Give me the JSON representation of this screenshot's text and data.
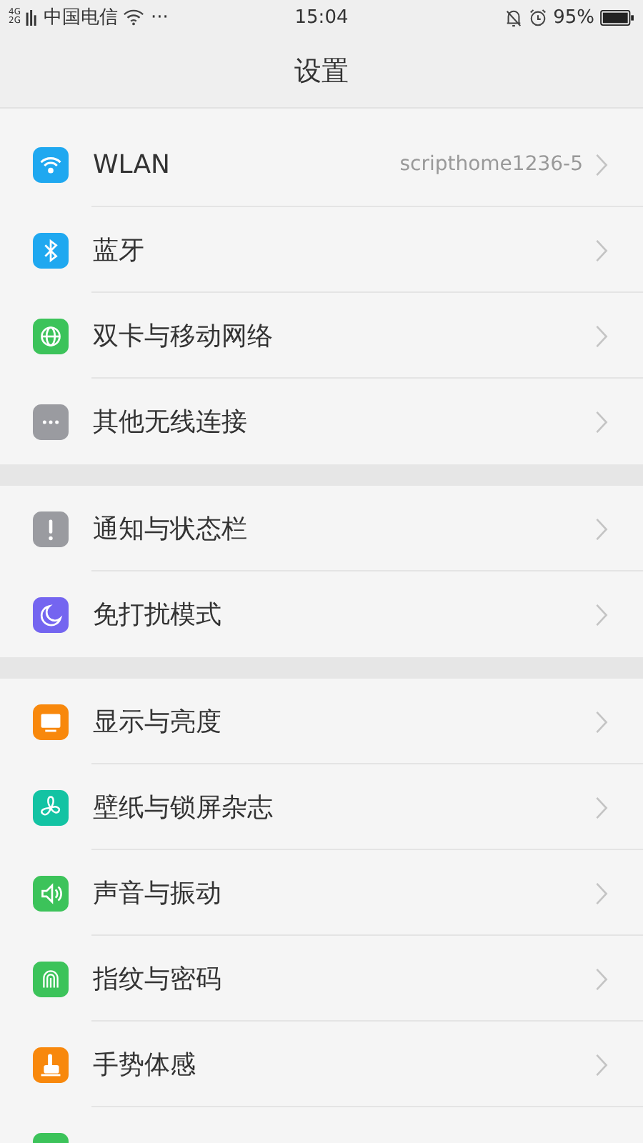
{
  "status_bar": {
    "network_labels": [
      "4G",
      "2G"
    ],
    "carrier": "中国电信",
    "more": "···",
    "time": "15:04",
    "battery": "95%"
  },
  "header": {
    "title": "设置"
  },
  "groups": [
    {
      "items": [
        {
          "kind": "wifi",
          "color": "#1fa8f0",
          "label": "WLAN",
          "value": "scripthome1236-5"
        },
        {
          "kind": "bluetooth",
          "color": "#1fa8f0",
          "label": "蓝牙"
        },
        {
          "kind": "globe",
          "color": "#3cc35a",
          "label": "双卡与移动网络"
        },
        {
          "kind": "more",
          "color": "#9a9ba0",
          "label": "其他无线连接"
        }
      ]
    },
    {
      "items": [
        {
          "kind": "notice",
          "color": "#9a9ba0",
          "label": "通知与状态栏"
        },
        {
          "kind": "moon",
          "color": "#7465f0",
          "label": "免打扰模式"
        }
      ]
    },
    {
      "items": [
        {
          "kind": "display",
          "color": "#f8880c",
          "label": "显示与亮度"
        },
        {
          "kind": "flower",
          "color": "#13c3a3",
          "label": "壁纸与锁屏杂志"
        },
        {
          "kind": "sound",
          "color": "#3cc35a",
          "label": "声音与振动"
        },
        {
          "kind": "fingerprint",
          "color": "#3cc35a",
          "label": "指纹与密码"
        },
        {
          "kind": "gesture",
          "color": "#f8880c",
          "label": "手势体感"
        },
        {
          "kind": "blank",
          "color": "#3cc35a"
        }
      ]
    }
  ]
}
